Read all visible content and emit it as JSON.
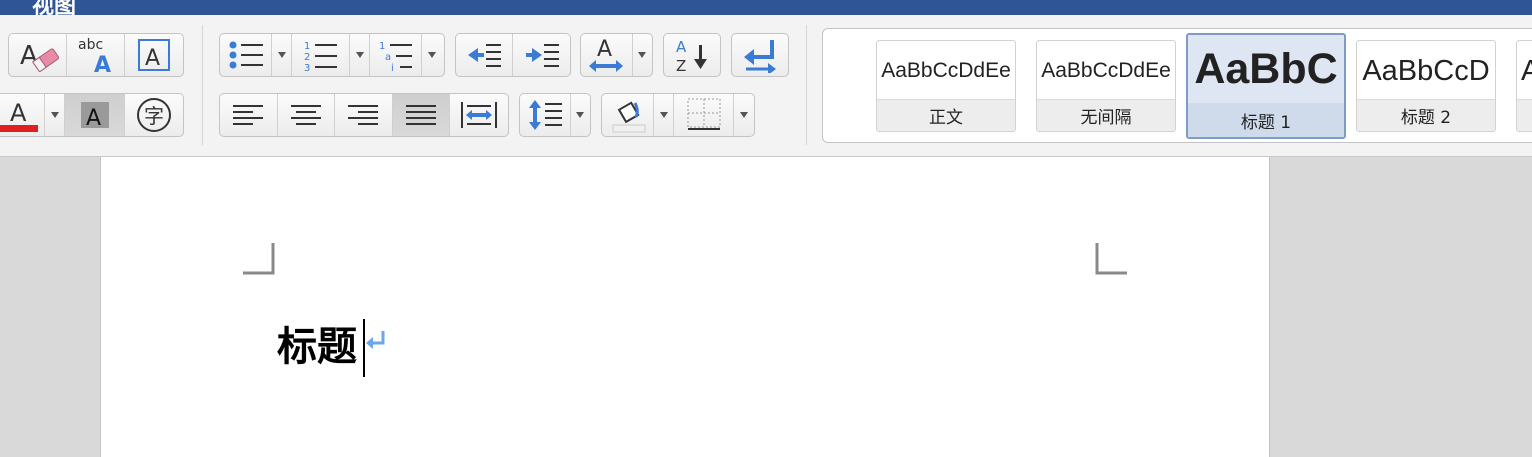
{
  "window": {
    "tab_label": "视图",
    "accent": "#2f5597"
  },
  "ribbon": {
    "font_tools": [
      "clear-formatting",
      "spell-check",
      "text-box",
      "font-color",
      "highlight",
      "character-border"
    ],
    "paragraph_tools": [
      "bullets",
      "numbering",
      "multilevel-list",
      "decrease-indent",
      "increase-indent",
      "text-direction",
      "sort",
      "show-marks",
      "align-left",
      "center",
      "align-right",
      "justify",
      "distributed",
      "line-spacing",
      "shading",
      "borders"
    ],
    "font_color_sample": {
      "letter": "A",
      "bar_color": "#e02020"
    },
    "highlight_letter": "A",
    "char_border_glyph": "字",
    "text_box_letter": "A",
    "clear_fmt_letter": "A",
    "abc_label": "abc",
    "abc_letter": "A",
    "text_direction_letter": "A",
    "sort_top": "A",
    "sort_bottom": "Z"
  },
  "styles": [
    {
      "preview": "AaBbCcDdEe",
      "name": "正文",
      "selected": false
    },
    {
      "preview": "AaBbCcDdEe",
      "name": "无间隔",
      "selected": false
    },
    {
      "preview": "AaBbC",
      "name": "标题 1",
      "selected": true
    },
    {
      "preview": "AaBbCcD",
      "name": "标题 2",
      "selected": false
    },
    {
      "preview": "A",
      "name": "",
      "selected": false
    }
  ],
  "document": {
    "text": "标题",
    "paragraph_mark": "↵"
  }
}
